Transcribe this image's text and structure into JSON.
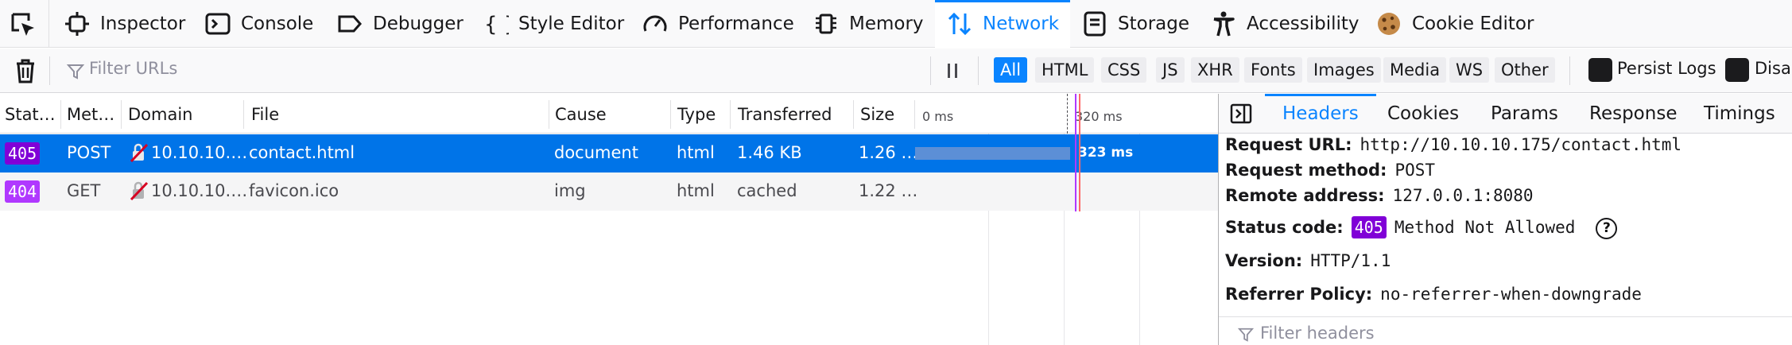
{
  "toolbar": {
    "tabs": [
      {
        "label": "Inspector",
        "icon": "inspector-icon"
      },
      {
        "label": "Console",
        "icon": "console-icon"
      },
      {
        "label": "Debugger",
        "icon": "debugger-icon"
      },
      {
        "label": "Style Editor",
        "icon": "style-editor-icon"
      },
      {
        "label": "Performance",
        "icon": "performance-icon"
      },
      {
        "label": "Memory",
        "icon": "memory-icon"
      },
      {
        "label": "Network",
        "icon": "network-icon",
        "active": true
      },
      {
        "label": "Storage",
        "icon": "storage-icon"
      },
      {
        "label": "Accessibility",
        "icon": "accessibility-icon"
      },
      {
        "label": "Cookie Editor",
        "icon": "cookie-icon"
      }
    ],
    "accent": "#0a84ff"
  },
  "filterbar": {
    "placeholder": "Filter URLs",
    "types": [
      "All",
      "HTML",
      "CSS",
      "JS",
      "XHR",
      "Fonts",
      "Images",
      "Media",
      "WS",
      "Other"
    ],
    "active_type": "All",
    "persist_logs": "Persist Logs",
    "disable_cache": "Disal"
  },
  "table": {
    "headers": [
      "Stat…",
      "Met…",
      "Domain",
      "File",
      "Cause",
      "Type",
      "Transferred",
      "Size"
    ],
    "waterfall_ticks": [
      "0 ms",
      "320 ms"
    ],
    "rows": [
      {
        "status": "405",
        "method": "POST",
        "domain": "10.10.10.…",
        "file": "contact.html",
        "cause": "document",
        "type": "html",
        "transferred": "1.46 KB",
        "size": "1.26 …",
        "time": "323 ms",
        "selected": true
      },
      {
        "status": "404",
        "method": "GET",
        "domain": "10.10.10.…",
        "file": "favicon.ico",
        "cause": "img",
        "type": "html",
        "transferred": "cached",
        "size": "1.22 …",
        "selected": false
      }
    ]
  },
  "details": {
    "tabs": [
      "Headers",
      "Cookies",
      "Params",
      "Response",
      "Timings"
    ],
    "active_tab": "Headers",
    "request_url_label": "Request URL:",
    "request_url": "http://10.10.10.175/contact.html",
    "request_method_label": "Request method:",
    "request_method": "POST",
    "remote_address_label": "Remote address:",
    "remote_address": "127.0.0.1:8080",
    "status_code_label": "Status code:",
    "status_code": "405",
    "status_text": "Method Not Allowed",
    "version_label": "Version:",
    "version": "HTTP/1.1",
    "referrer_policy_label": "Referrer Policy:",
    "referrer_policy": "no-referrer-when-downgrade",
    "filter_placeholder": "Filter headers"
  }
}
